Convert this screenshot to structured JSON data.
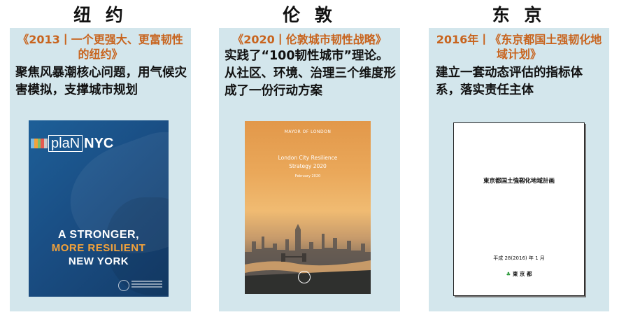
{
  "columns": [
    {
      "city": "纽 约",
      "plan_title": "《2013丨一个更强大、更富韧性的纽约》",
      "description": "聚焦风暴潮核心问题，用气候灾害模拟，支撑城市规划",
      "cover": {
        "logo_text": "NYC",
        "logo_boxed": "plaN",
        "line1": "A STRONGER,",
        "line2": "MORE RESILIENT",
        "line3": "NEW YORK"
      }
    },
    {
      "city": "伦 敦",
      "plan_title": "《2020丨伦敦城市韧性战略》",
      "description": "实践了“100韧性城市”理论。从社区、环境、治理三个维度形成了一份行动方案",
      "cover": {
        "mayor": "MAYOR OF LONDON",
        "title_line1": "London City Resilience",
        "title_line2": "Strategy 2020",
        "date": "February 2020"
      }
    },
    {
      "city": "东 京",
      "plan_title": "2016年丨《东京都国土强韧化地域计划》",
      "description": "建立一套动态评估的指标体系，落实责任主体",
      "cover": {
        "title": "東京都国土強靱化地域計画",
        "date": "平成 28(2016) 年 1 月",
        "org": "東 京 都",
        "org_icon": "ginkgo-leaf-icon"
      }
    }
  ],
  "colors": {
    "panel_bg": "#d3e6ec",
    "plan_title": "#c8641e",
    "nyc_blue": "#1a4e84",
    "nyc_orange": "#f3a23a",
    "tokyo_green": "#2e9a3c"
  }
}
